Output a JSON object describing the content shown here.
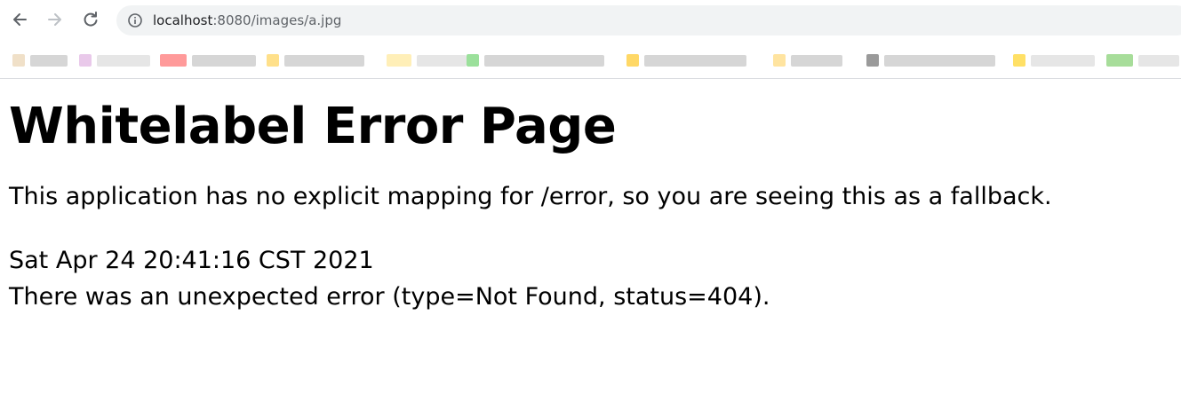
{
  "browser": {
    "url_host": "localhost",
    "url_path": ":8080/images/a.jpg",
    "icons": {
      "back": "arrow-left-icon",
      "forward": "arrow-right-icon",
      "reload": "reload-icon",
      "site_info": "info-circle-icon"
    }
  },
  "bookmarks": [
    {
      "color": "#e9c9ea"
    },
    {
      "color": "#ff9a9a"
    },
    {
      "color": "#ffe08a"
    },
    {
      "color": "#ffefb8"
    },
    {
      "color": "#9be09b"
    },
    {
      "color": "#ffd866"
    },
    {
      "color": "#ffe4a0"
    },
    {
      "color": "#9a9a9a"
    },
    {
      "color": "#ffe066"
    },
    {
      "color": "#a7dd9a"
    }
  ],
  "page": {
    "title": "Whitelabel Error Page",
    "message": "This application has no explicit mapping for /error, so you are seeing this as a fallback.",
    "timestamp": "Sat Apr 24 20:41:16 CST 2021",
    "error": "There was an unexpected error (type=Not Found, status=404)."
  }
}
